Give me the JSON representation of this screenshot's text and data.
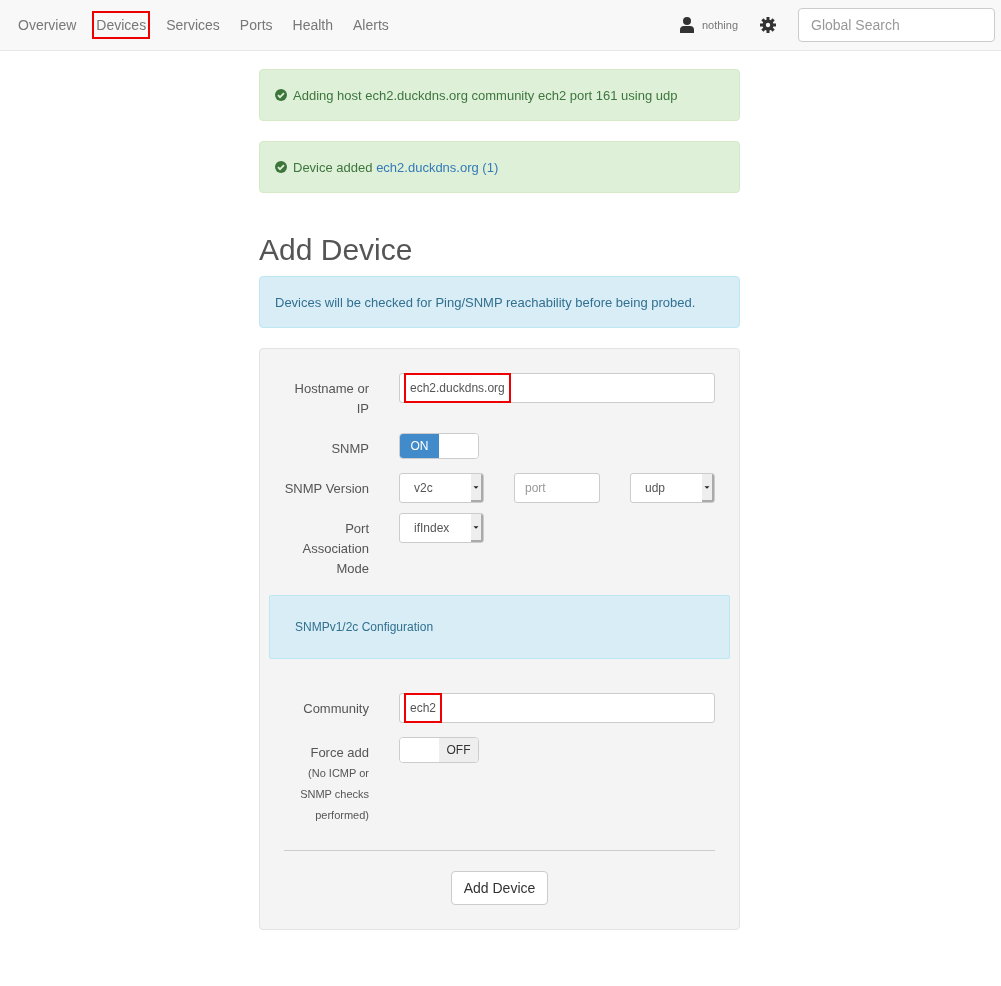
{
  "nav": {
    "items": [
      {
        "label": "Overview",
        "highlighted": false
      },
      {
        "label": "Devices",
        "highlighted": true
      },
      {
        "label": "Services",
        "highlighted": false
      },
      {
        "label": "Ports",
        "highlighted": false
      },
      {
        "label": "Health",
        "highlighted": false
      },
      {
        "label": "Alerts",
        "highlighted": false
      }
    ],
    "user": "nothing",
    "search": {
      "placeholder": "Global Search"
    }
  },
  "alerts": [
    {
      "text": "Adding host ech2.duckdns.org community ech2 port 161 using udp"
    },
    {
      "text": "Device added ",
      "link": "ech2.duckdns.org (1)"
    }
  ],
  "heading": "Add Device",
  "info": "Devices will be checked for Ping/SNMP reachability before being probed.",
  "form": {
    "rows": [
      {
        "kind": "text",
        "label": "Hostname or IP",
        "value": "ech2.duckdns.org",
        "highlighted": true
      },
      {
        "kind": "toggle",
        "label": "SNMP",
        "on": true,
        "on_text": "ON",
        "off_text": ""
      },
      {
        "kind": "controls",
        "label": "SNMP Version",
        "controls": [
          {
            "kind": "select",
            "value": "v2c"
          },
          {
            "kind": "input",
            "placeholder": "port"
          },
          {
            "kind": "select",
            "value": "udp"
          }
        ]
      },
      {
        "kind": "controls",
        "label": "Port Association Mode",
        "controls": [
          {
            "kind": "select",
            "value": "ifIndex"
          }
        ]
      },
      {
        "kind": "section",
        "label": "SNMPv1/2c Configuration"
      },
      {
        "kind": "text",
        "label": "Community",
        "value": "ech2",
        "highlighted": true
      },
      {
        "kind": "toggle",
        "label": "Force add",
        "note": "(No ICMP or SNMP checks performed)",
        "on": false,
        "on_text": "",
        "off_text": "OFF"
      }
    ],
    "submit": "Add Device"
  }
}
